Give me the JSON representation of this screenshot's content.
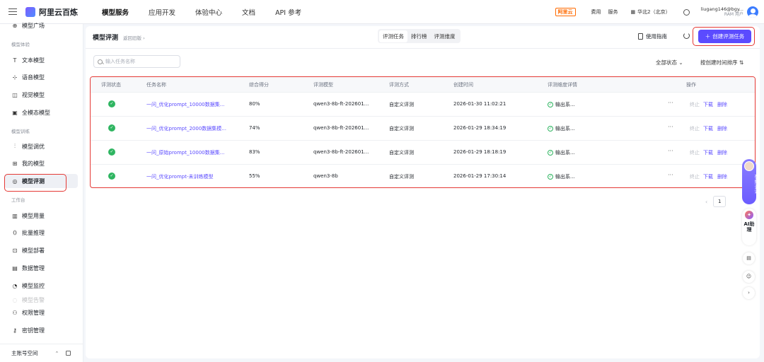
{
  "topbar": {
    "brand": "阿里云百炼",
    "nav": [
      "模型服务",
      "应用开发",
      "体验中心",
      "文档",
      "API 参考"
    ],
    "active_nav": "模型服务",
    "aliyun_badge": "阿里云",
    "links": [
      "费用",
      "服务"
    ],
    "region": "华北2（北京）",
    "user_name": "liugang146@bgy...",
    "user_role": "RAM 用户"
  },
  "sidebar": {
    "top_item": "模型广场",
    "section_experience": "模型体验",
    "experience_items": [
      {
        "label": "文本模型",
        "icon": "T"
      },
      {
        "label": "语音模型",
        "icon": "⊹"
      },
      {
        "label": "视觉模型",
        "icon": "◫"
      },
      {
        "label": "全模态模型",
        "icon": "▣"
      }
    ],
    "section_training": "模型训练",
    "training_items": [
      {
        "label": "模型调优",
        "icon": "⫶"
      },
      {
        "label": "我的模型",
        "icon": "⊞"
      },
      {
        "label": "模型评测",
        "icon": "◎"
      }
    ],
    "section_workbench": "工作台",
    "workbench_items": [
      {
        "label": "模型用量",
        "icon": "▥"
      },
      {
        "label": "批量推理",
        "icon": "⦅⦆"
      },
      {
        "label": "模型部署",
        "icon": "⊡"
      },
      {
        "label": "数据管理",
        "icon": "▤"
      },
      {
        "label": "模型监控",
        "icon": "◔"
      }
    ],
    "faded_item": "模型告警",
    "admin_items": [
      {
        "label": "权限管理",
        "icon": "⚇"
      },
      {
        "label": "密钥管理",
        "icon": "⚷"
      }
    ],
    "footer": "主账号空间"
  },
  "main": {
    "title": "模型评测",
    "back": "返回旧版",
    "tabs": [
      "评测任务",
      "排行榜",
      "评测维度"
    ],
    "guide": "使用指南",
    "create_button": "创建评测任务",
    "search_placeholder": "输入任务名称",
    "filter": "全部状态",
    "sort": "按创建时间排序",
    "columns": [
      "评测状态",
      "任务名称",
      "综合得分",
      "评测模型",
      "评测方式",
      "创建时间",
      "评测维度详情",
      "操作"
    ],
    "rows": [
      {
        "name": "一问_优化prompt_10000数据集...",
        "score": "80%",
        "model": "qwen3-8b-ft-202601...",
        "method": "自定义评测",
        "created": "2026-01-30 11:02:21",
        "dim": "输出系..."
      },
      {
        "name": "一问_优化prompt_2000数据集模...",
        "score": "74%",
        "model": "qwen3-8b-ft-202601...",
        "method": "自定义评测",
        "created": "2026-01-29 18:34:19",
        "dim": "输出系..."
      },
      {
        "name": "一问_原始prompt_10000数据集...",
        "score": "83%",
        "model": "qwen3-8b-ft-202601...",
        "method": "自定义评测",
        "created": "2026-01-29 18:18:19",
        "dim": "输出系..."
      },
      {
        "name": "一问_优化prompt-未训练模型",
        "score": "55%",
        "model": "qwen3-8b",
        "method": "自定义评测",
        "created": "2026-01-29 17:30:14",
        "dim": "输出系..."
      }
    ],
    "ops": {
      "stop": "终止",
      "download": "下载",
      "delete": "删除",
      "more": "···"
    },
    "pager": {
      "current": "1"
    }
  },
  "floats": {
    "assistant": "在线咨询",
    "ai": "AI助理"
  },
  "colors": {
    "accent": "#5b4bff",
    "success": "#2fb561",
    "highlight": "#e53935"
  }
}
